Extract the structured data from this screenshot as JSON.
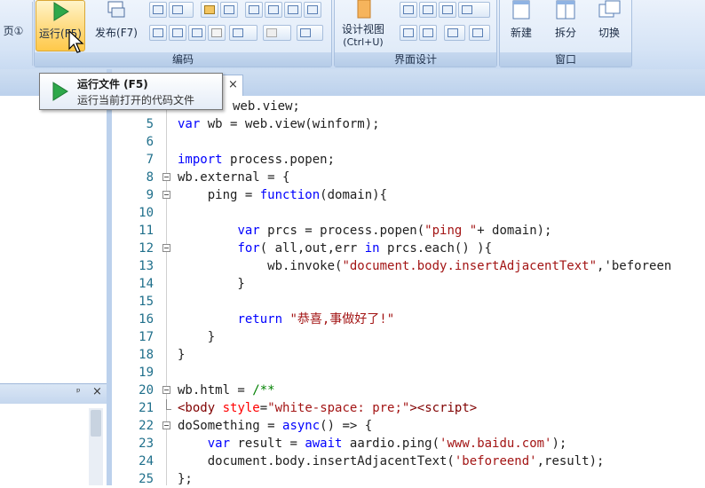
{
  "ribbon": {
    "page_setup_label": "页①",
    "run_label": "运行(F5)",
    "publish_label": "发布(F7)",
    "design_view_label": "设计视图",
    "design_view_shortcut": "(Ctrl+U)",
    "new_label": "新建",
    "split_label": "拆分",
    "switch_label": "切换",
    "groups": {
      "code": "编码",
      "ui_design": "界面设计",
      "window": "窗口"
    }
  },
  "tooltip": {
    "title": "运行文件 (F5)",
    "description": "运行当前打开的代码文件"
  },
  "editor": {
    "tab_close": "×",
    "panel_pin": "ᵖ",
    "panel_close": "×"
  },
  "code_lines": [
    {
      "n": "",
      "text": "web.view;"
    },
    {
      "n": "5",
      "text": "var wb = web.view(winform);"
    },
    {
      "n": "6",
      "text": ""
    },
    {
      "n": "7",
      "text": "import process.popen;"
    },
    {
      "n": "8",
      "text": "wb.external = {"
    },
    {
      "n": "9",
      "text": "    ping = function(domain){"
    },
    {
      "n": "10",
      "text": ""
    },
    {
      "n": "11",
      "text": "        var prcs = process.popen(\"ping \"+ domain);"
    },
    {
      "n": "12",
      "text": "        for( all,out,err in prcs.each() ){"
    },
    {
      "n": "13",
      "text": "            wb.invoke(\"document.body.insertAdjacentText\",'beforeen"
    },
    {
      "n": "14",
      "text": "        }"
    },
    {
      "n": "15",
      "text": ""
    },
    {
      "n": "16",
      "text": "        return \"恭喜,事做好了!\""
    },
    {
      "n": "17",
      "text": "    }"
    },
    {
      "n": "18",
      "text": "}"
    },
    {
      "n": "19",
      "text": ""
    },
    {
      "n": "20",
      "text": "wb.html = /**"
    },
    {
      "n": "21",
      "text": "<body style=\"white-space: pre;\"><script>"
    },
    {
      "n": "22",
      "text": "doSomething = async() => {"
    },
    {
      "n": "23",
      "text": "    var result = await aardio.ping('www.baidu.com');"
    },
    {
      "n": "24",
      "text": "    document.body.insertAdjacentText('beforeend',result);"
    },
    {
      "n": "25",
      "text": "};"
    }
  ],
  "colors": {
    "keyword": "#0000ff",
    "string": "#a31515",
    "tag": "#800000",
    "attribute": "#ff0000",
    "line_number": "#1f6f8b"
  }
}
